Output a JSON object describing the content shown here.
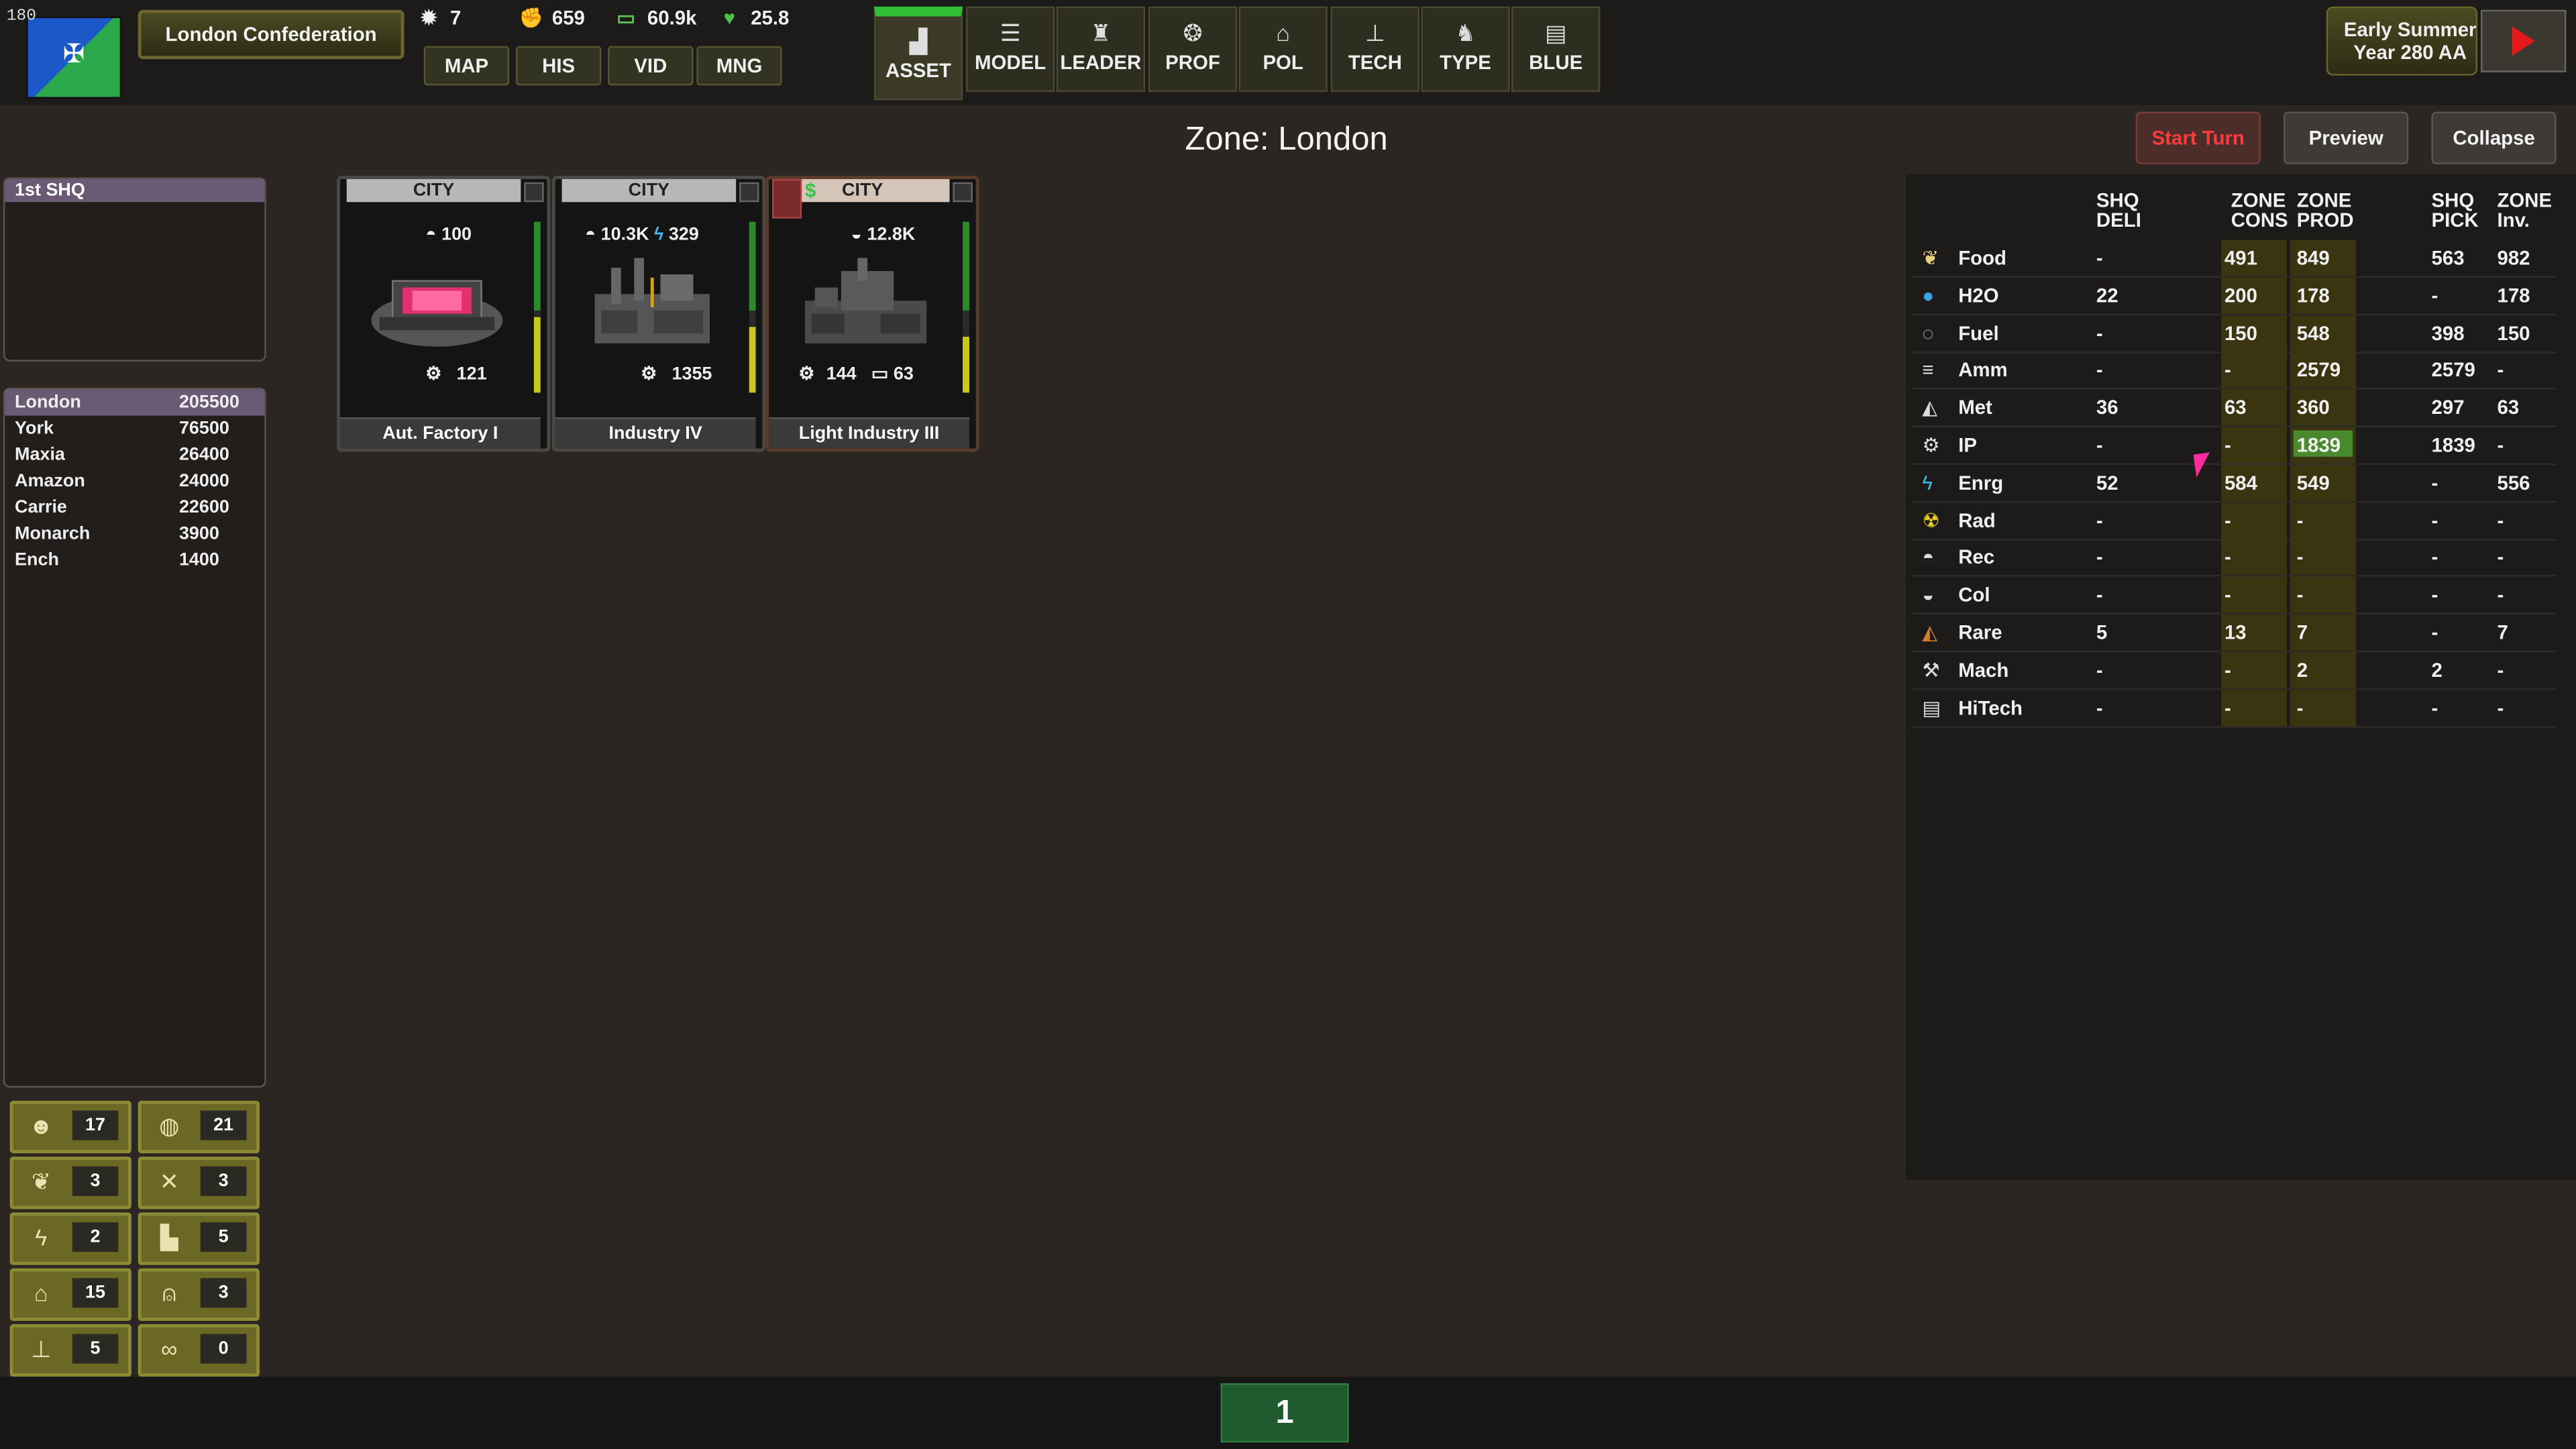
{
  "top": {
    "corner_number": "180",
    "nation": "London Confederation",
    "stats": [
      {
        "icon": "sun-icon",
        "value": "7"
      },
      {
        "icon": "fist-icon",
        "value": "659"
      },
      {
        "icon": "money-icon",
        "value": "60.9k"
      },
      {
        "icon": "heart-icon",
        "value": "25.8"
      }
    ],
    "nav": [
      "MAP",
      "HIS",
      "VID",
      "MNG"
    ],
    "main_buttons": [
      "ASSET",
      "MODEL",
      "LEADER",
      "PROF",
      "POL",
      "TECH",
      "TYPE",
      "BLUE"
    ],
    "date_line1": "Early Summer",
    "date_line2": "Year 280 AA"
  },
  "header": {
    "zone_title": "Zone: London",
    "start_turn": "Start Turn",
    "preview": "Preview",
    "collapse": "Collapse"
  },
  "left": {
    "shq_label": "1st SHQ",
    "zones": [
      {
        "name": "London",
        "value": "205500"
      },
      {
        "name": "York",
        "value": "76500"
      },
      {
        "name": "Maxia",
        "value": "26400"
      },
      {
        "name": "Amazon",
        "value": "24000"
      },
      {
        "name": "Carrie",
        "value": "22600"
      },
      {
        "name": "Monarch",
        "value": "3900"
      },
      {
        "name": "Ench",
        "value": "1400"
      }
    ],
    "tiles": [
      {
        "icon": "soldier-icon",
        "value": "17"
      },
      {
        "icon": "helmet-icon",
        "value": "21"
      },
      {
        "icon": "wheat-icon",
        "value": "3"
      },
      {
        "icon": "tools-icon",
        "value": "3"
      },
      {
        "icon": "lightning-icon",
        "value": "2"
      },
      {
        "icon": "factory-icon",
        "value": "5"
      },
      {
        "icon": "bank-icon",
        "value": "15"
      },
      {
        "icon": "robot-icon",
        "value": "3"
      },
      {
        "icon": "network-icon",
        "value": "5"
      },
      {
        "icon": "chain-icon",
        "value": "0"
      }
    ]
  },
  "cards": [
    {
      "type": "CITY",
      "name": "Aut. Factory I",
      "stat_top": "100",
      "stat_bottom": "121"
    },
    {
      "type": "CITY",
      "name": "Industry IV",
      "stat_top": "10.3K",
      "stat_top2": "329",
      "stat_bottom": "1355"
    },
    {
      "type": "CITY",
      "name": "Light Industry III",
      "stat_top": "12.8K",
      "stat_bottom": "144",
      "stat_bottom2": "63"
    }
  ],
  "resources": {
    "headers": {
      "shq_deli": [
        "SHQ",
        "DELI"
      ],
      "zone_cons": [
        "ZONE",
        "CONS"
      ],
      "zone_prod": [
        "ZONE",
        "PROD"
      ],
      "shq_pick": [
        "SHQ",
        "PICK"
      ],
      "zone_inv": [
        "ZONE",
        "Inv."
      ]
    },
    "rows": [
      {
        "name": "Food",
        "icon": "wheat-icon",
        "deli": "-",
        "cons": "491",
        "prod": "849",
        "pick": "563",
        "inv": "982"
      },
      {
        "name": "H2O",
        "icon": "water-drop-icon",
        "deli": "22",
        "cons": "200",
        "prod": "178",
        "pick": "-",
        "inv": "178"
      },
      {
        "name": "Fuel",
        "icon": "fuel-drop-icon",
        "deli": "-",
        "cons": "150",
        "prod": "548",
        "pick": "398",
        "inv": "150"
      },
      {
        "name": "Amm",
        "icon": "ammo-icon",
        "deli": "-",
        "cons": "-",
        "prod": "2579",
        "pick": "2579",
        "inv": "-"
      },
      {
        "name": "Met",
        "icon": "metal-icon",
        "deli": "36",
        "cons": "63",
        "prod": "360",
        "pick": "297",
        "inv": "63"
      },
      {
        "name": "IP",
        "icon": "gear-icon",
        "deli": "-",
        "cons": "-",
        "prod": "1839",
        "pick": "1839",
        "inv": "-"
      },
      {
        "name": "Enrg",
        "icon": "lightning-icon",
        "deli": "52",
        "cons": "584",
        "prod": "549",
        "pick": "-",
        "inv": "556"
      },
      {
        "name": "Rad",
        "icon": "radiation-icon",
        "deli": "-",
        "cons": "-",
        "prod": "-",
        "pick": "-",
        "inv": "-"
      },
      {
        "name": "Rec",
        "icon": "rec-icon",
        "deli": "-",
        "cons": "-",
        "prod": "-",
        "pick": "-",
        "inv": "-"
      },
      {
        "name": "Col",
        "icon": "col-icon",
        "deli": "-",
        "cons": "-",
        "prod": "-",
        "pick": "-",
        "inv": "-"
      },
      {
        "name": "Rare",
        "icon": "rare-icon",
        "deli": "5",
        "cons": "13",
        "prod": "7",
        "pick": "-",
        "inv": "7"
      },
      {
        "name": "Mach",
        "icon": "machine-icon",
        "deli": "-",
        "cons": "-",
        "prod": "2",
        "pick": "2",
        "inv": "-"
      },
      {
        "name": "HiTech",
        "icon": "hitech-icon",
        "deli": "-",
        "cons": "-",
        "prod": "-",
        "pick": "-",
        "inv": "-"
      }
    ]
  },
  "page_number": "1",
  "colors": {
    "accent_green": "#2fbf35",
    "start_turn_red": "#ff3b3b",
    "highlight_prod": "#4a8a2e"
  }
}
